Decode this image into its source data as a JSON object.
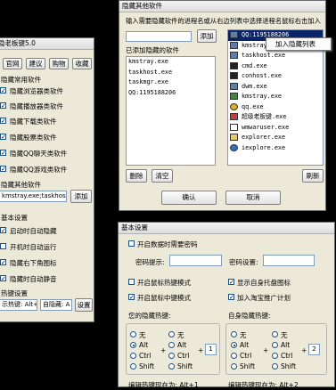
{
  "main_window": {
    "title": "隐老板键5.0",
    "tabs": [
      "官网",
      "建议",
      "购物",
      "收藏"
    ],
    "section_common": "隐藏常用软件",
    "common_items": [
      {
        "label": "隐藏浏览器类软件",
        "checked": true
      },
      {
        "label": "隐藏播放器类软件",
        "checked": true
      },
      {
        "label": "隐藏下载类软件",
        "checked": true
      },
      {
        "label": "隐藏股票类软件",
        "checked": true
      },
      {
        "label": "隐藏QQ聊天类软件",
        "checked": true
      },
      {
        "label": "隐藏QQ游戏类软件",
        "checked": true
      }
    ],
    "section_other": "隐藏其他软件",
    "other_input": "kmstray.exe;taskhost.",
    "add_button": "添加",
    "section_basic": "基本设置",
    "basic_items": [
      {
        "label": "启动时自动隐藏",
        "checked": true
      },
      {
        "label": "开机时自动运行",
        "checked": false
      },
      {
        "label": "隐藏右下角图标",
        "checked": true
      },
      {
        "label": "隐藏时自动静音",
        "checked": true
      }
    ],
    "section_hotkey": "热键设置",
    "hotkey_show_input": "示热键: Alt+1",
    "hotkey_hide_input": "自隐藏: A",
    "settings_button": "设置"
  },
  "hide_dialog": {
    "title": "隐藏其他软件",
    "instruction": "输入需要隐藏软件的进程名或从右边列表中选择进程名鼠标右击加入",
    "add_button": "添加",
    "added_label": "已添加隐藏的软件",
    "added_list": [
      "kmstray.exe",
      "taskhost.exe",
      "taskmgr.exe",
      "QQ:1195188206"
    ],
    "process_list": [
      {
        "name": "QQ:1195188206",
        "selected": true
      },
      {
        "name": "kmstray.exe",
        "selected": false
      },
      {
        "name": "taskhost.exe",
        "selected": false
      },
      {
        "name": "cmd.exe",
        "selected": false
      },
      {
        "name": "conhost.exe",
        "selected": false
      },
      {
        "name": "dwm.exe",
        "selected": false
      },
      {
        "name": "kmstray.exe",
        "selected": false
      },
      {
        "name": "qq.exe",
        "selected": false
      },
      {
        "name": "超级老板键.exe",
        "selected": false
      },
      {
        "name": "wmwaruser.exe",
        "selected": false
      },
      {
        "name": "explorer.exe",
        "selected": false
      },
      {
        "name": "iexplore.exe",
        "selected": false
      }
    ],
    "context_menu_item": "加入隐藏列表",
    "delete_button": "删除",
    "clear_button": "清空",
    "refresh_button": "刷新",
    "ok_button": "确认",
    "cancel_button": "取消"
  },
  "basic_dialog": {
    "title": "基本设置",
    "password_checkbox": {
      "label": "开启数据时需要密码",
      "checked": false
    },
    "password_hint_label": "密码提示:",
    "password_set_label": "密码设置:",
    "options": [
      {
        "label": "开启鼠标热键模式",
        "checked": false
      },
      {
        "label": "显示自身托盘图标",
        "checked": true
      },
      {
        "label": "开启鼠标中键模式",
        "checked": true
      },
      {
        "label": "加入淘宝推广计划",
        "checked": true
      }
    ],
    "group_show_title": "您的隐藏热键:",
    "group_hide_title": "自身隐藏热键:",
    "radio_none": "无",
    "radio_alt": "Alt",
    "radio_ctrl": "Ctrl",
    "radio_shift": "Shift",
    "plus_sign": "+",
    "key_show": "1",
    "key_hide": "2",
    "footer_left": "编辑热键现在为: Alt+1",
    "footer_right": "编辑热键现在为: Alt+2"
  }
}
